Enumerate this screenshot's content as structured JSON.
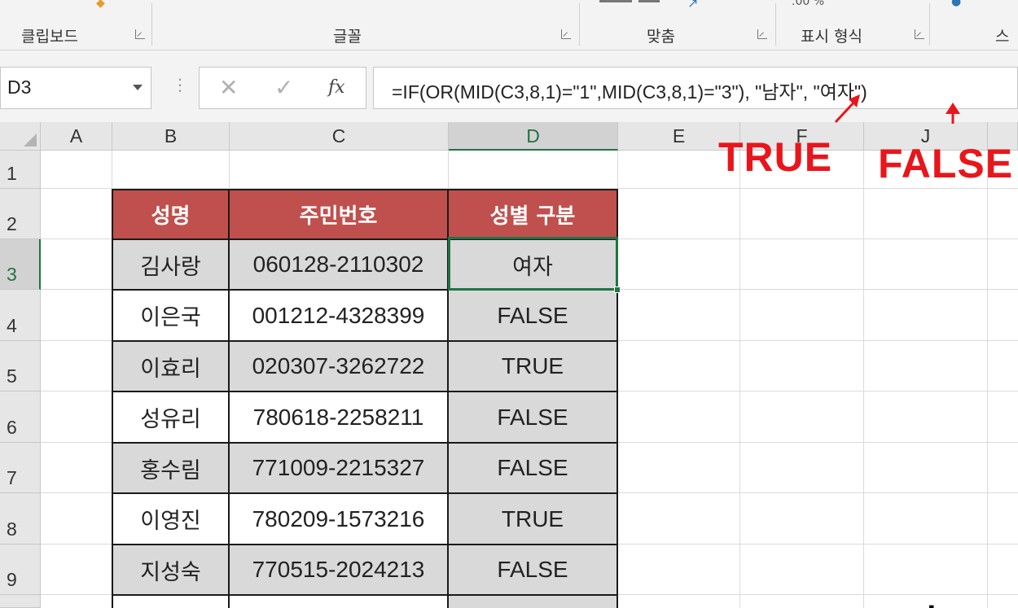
{
  "ribbon": {
    "groups": [
      "클립보드",
      "글꼴",
      "맞춤",
      "표시 형식",
      "스"
    ],
    "number_format_glyphs": ".00  %"
  },
  "formula_bar": {
    "name_box": "D3",
    "cancel_glyph": "✕",
    "enter_glyph": "✓",
    "fx_label": "fx",
    "formula": "=IF(OR(MID(C3,8,1)=\"1\",MID(C3,8,1)=\"3\"), \"남자\", \"여자\")"
  },
  "columns": [
    "A",
    "B",
    "C",
    "D",
    "E",
    "F",
    "J"
  ],
  "selected_column": "D",
  "rows": [
    "1",
    "2",
    "3",
    "4",
    "5",
    "6",
    "7",
    "8",
    "9"
  ],
  "selected_row": "3",
  "table": {
    "headers": [
      "성명",
      "주민번호",
      "성별 구분"
    ],
    "records": [
      {
        "name": "김사랑",
        "id": "060128-2110302",
        "gender": "여자"
      },
      {
        "name": "이은국",
        "id": "001212-4328399",
        "gender": "FALSE"
      },
      {
        "name": "이효리",
        "id": "020307-3262722",
        "gender": "TRUE"
      },
      {
        "name": "성유리",
        "id": "780618-2258211",
        "gender": "FALSE"
      },
      {
        "name": "홍수림",
        "id": "771009-2215327",
        "gender": "FALSE"
      },
      {
        "name": "이영진",
        "id": "780209-1573216",
        "gender": "TRUE"
      },
      {
        "name": "지성숙",
        "id": "770515-2024213",
        "gender": "FALSE"
      }
    ]
  },
  "annotations": {
    "true_label": "TRUE",
    "false_label": "FALSE",
    "color": "#e8161c"
  },
  "colors": {
    "header_fill": "#c0504d",
    "selection": "#217346",
    "band_gray": "#d9d9d9"
  }
}
